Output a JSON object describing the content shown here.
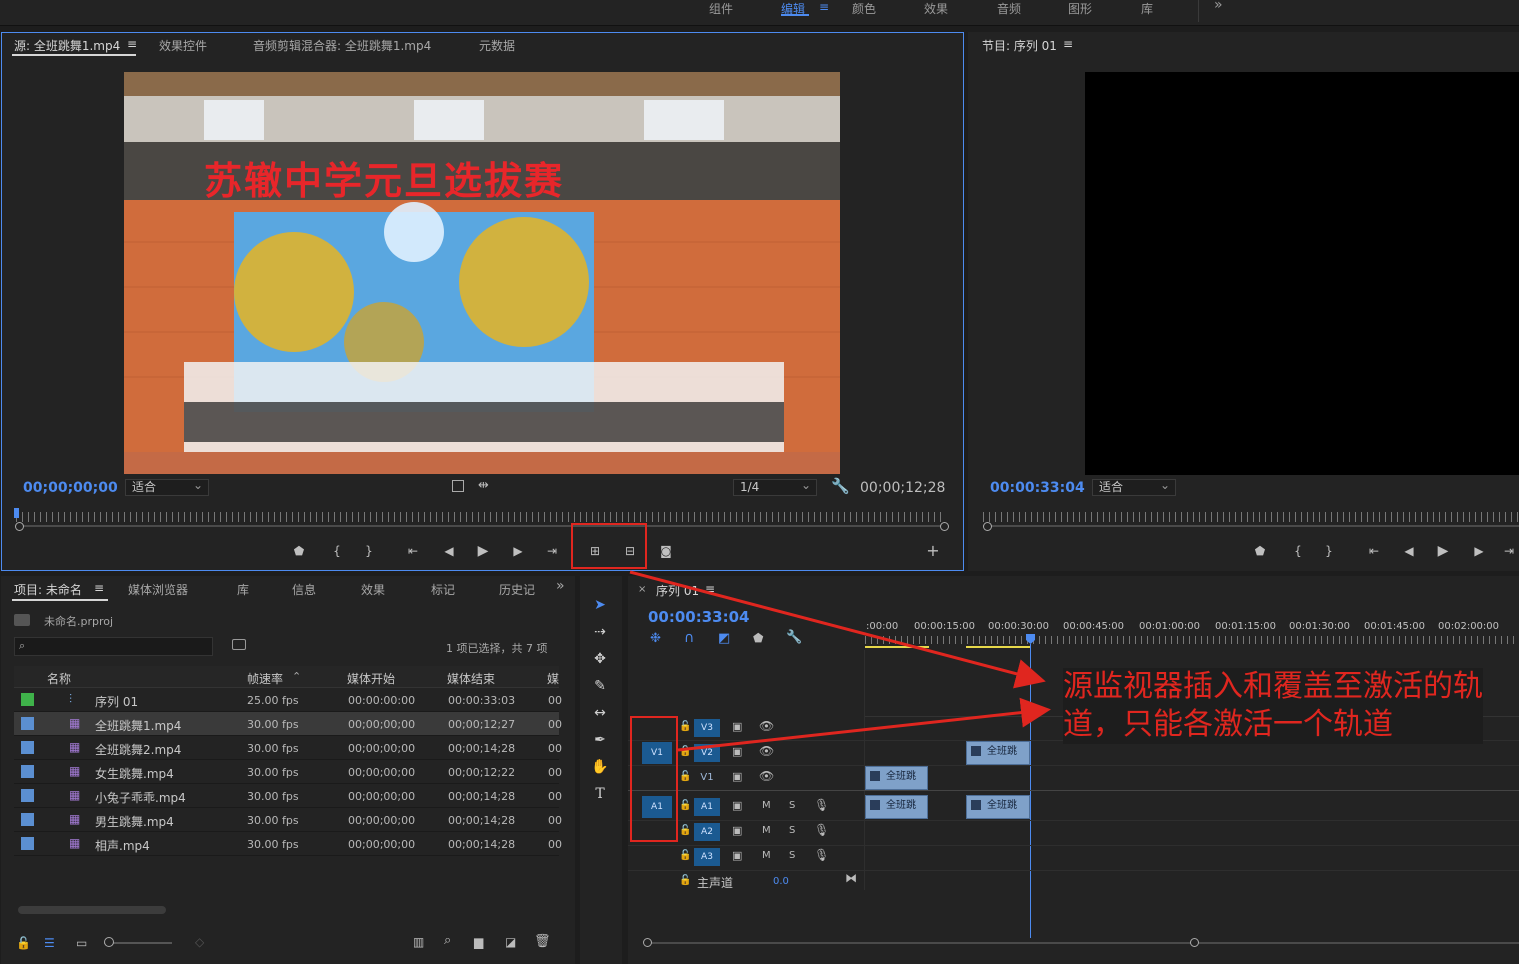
{
  "workspaces": {
    "items": [
      "组件",
      "编辑",
      "颜色",
      "效果",
      "音频",
      "图形",
      "库"
    ],
    "more": "»",
    "menu": "≡"
  },
  "source_panel": {
    "tabs": [
      "源: 全班跳舞1.mp4",
      "效果控件",
      "音频剪辑混合器: 全班跳舞1.mp4",
      "元数据"
    ],
    "tab_menu": "≡",
    "video_banner_text": "苏辙中学元旦选拔赛",
    "timecode_in": "00;00;00;00",
    "fit": "适合",
    "resolution": "1/4",
    "duration": "00;00;12;28"
  },
  "program_panel": {
    "tab": "节目: 序列 01",
    "tab_menu": "≡",
    "timecode": "00:00:33:04",
    "fit": "适合"
  },
  "project_panel": {
    "tabs": [
      "项目: 未命名",
      "媒体浏览器",
      "库",
      "信息",
      "效果",
      "标记",
      "历史记"
    ],
    "tab_menu": "≡",
    "project_file": "未命名.prproj",
    "search_placeholder": "",
    "selection_info": "1 项已选择，共 7 项",
    "columns": [
      "名称",
      "帧速率",
      "媒体开始",
      "媒体结束",
      "媒"
    ],
    "rows": [
      {
        "name": "序列 01",
        "fps": "25.00 fps",
        "start": "00:00:00:00",
        "end": "00:00:33:03",
        "color": "#3fb24a",
        "type": "sequence"
      },
      {
        "name": "全班跳舞1.mp4",
        "fps": "30.00 fps",
        "start": "00;00;00;00",
        "end": "00;00;12;27",
        "color": "#5b8fd1",
        "type": "clip"
      },
      {
        "name": "全班跳舞2.mp4",
        "fps": "30.00 fps",
        "start": "00;00;00;00",
        "end": "00;00;14;28",
        "color": "#5b8fd1",
        "type": "clip"
      },
      {
        "name": "女生跳舞.mp4",
        "fps": "30.00 fps",
        "start": "00;00;00;00",
        "end": "00;00;12;22",
        "color": "#5b8fd1",
        "type": "clip"
      },
      {
        "name": "小兔子乖乖.mp4",
        "fps": "30.00 fps",
        "start": "00;00;00;00",
        "end": "00;00;14;28",
        "color": "#5b8fd1",
        "type": "clip"
      },
      {
        "name": "男生跳舞.mp4",
        "fps": "30.00 fps",
        "start": "00;00;00;00",
        "end": "00;00;14;28",
        "color": "#5b8fd1",
        "type": "clip"
      },
      {
        "name": "相声.mp4",
        "fps": "30.00 fps",
        "start": "00;00;00;00",
        "end": "00;00;14;28",
        "color": "#5b8fd1",
        "type": "clip"
      }
    ],
    "selected_row": 1
  },
  "timeline": {
    "tab": "序列 01",
    "tab_close": "×",
    "tab_menu": "≡",
    "timecode": "00:00:33:04",
    "ruler_labels": [
      ":00:00",
      "00:00:15:00",
      "00:00:30:00",
      "00:00:45:00",
      "00:01:00:00",
      "00:01:15:00",
      "00:01:30:00",
      "00:01:45:00",
      "00:02:00:00"
    ],
    "source_patch": {
      "video": "V1",
      "audio": "A1"
    },
    "video_tracks": [
      "V3",
      "V2",
      "V1"
    ],
    "audio_tracks": [
      "A1",
      "A2",
      "A3"
    ],
    "mute_label": "M",
    "solo_label": "S",
    "master": {
      "label": "主声道",
      "value": "0.0"
    },
    "clip_label": "全班跳"
  },
  "annotation": {
    "text_line1": "源监视器插入和覆盖至激活的轨",
    "text_line2": "道，只能各激活一个轨道",
    "color": "#e0261f"
  },
  "accent": "#4d8bf0"
}
